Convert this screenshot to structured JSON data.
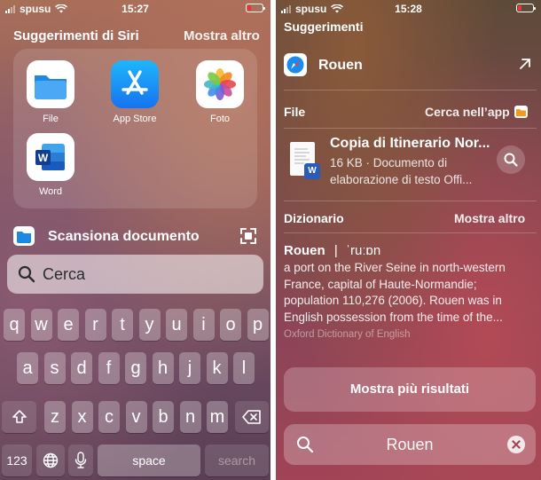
{
  "left": {
    "status": {
      "carrier": "spusu",
      "time": "15:27"
    },
    "siri": {
      "title": "Suggerimenti di Siri",
      "more": "Mostra altro"
    },
    "apps": [
      {
        "label": "File",
        "icon": "files-app-icon"
      },
      {
        "label": "App Store",
        "icon": "app-store-icon"
      },
      {
        "label": "Foto",
        "icon": "photos-app-icon"
      },
      {
        "label": "Word",
        "icon": "word-app-icon"
      }
    ],
    "shortcut": {
      "label": "Scansiona documento"
    },
    "search": {
      "placeholder": "Cerca"
    },
    "keyboard": {
      "row1": [
        "q",
        "w",
        "e",
        "r",
        "t",
        "y",
        "u",
        "i",
        "o",
        "p"
      ],
      "row2": [
        "a",
        "s",
        "d",
        "f",
        "g",
        "h",
        "j",
        "k",
        "l"
      ],
      "row3": [
        "z",
        "x",
        "c",
        "v",
        "b",
        "n",
        "m"
      ],
      "numbers": "123",
      "space": "space",
      "search": "search"
    }
  },
  "right": {
    "status": {
      "carrier": "spusu",
      "time": "15:28"
    },
    "header": "Suggerimenti",
    "top_hit": {
      "label": "Rouen"
    },
    "files": {
      "title": "File",
      "action": "Cerca nell’app",
      "doc_title": "Copia di Itinerario Nor...",
      "doc_desc": "16 KB · Documento di elaborazione di testo Offi..."
    },
    "dictionary": {
      "title": "Dizionario",
      "more": "Mostra altro",
      "word": "Rouen",
      "separator": "|",
      "pronunciation": "ˈruːɒn",
      "definition": "a port on the River Seine in north-western France, capital of Haute-Normandie; population 110,276 (2006). Rouen was in English possession from the time of the...",
      "source": "Oxford Dictionary of English"
    },
    "more_results": "Mostra più risultati",
    "search": {
      "query": "Rouen"
    }
  },
  "colors": {
    "accent": "#ffffff",
    "battery_low": "#e33333"
  }
}
